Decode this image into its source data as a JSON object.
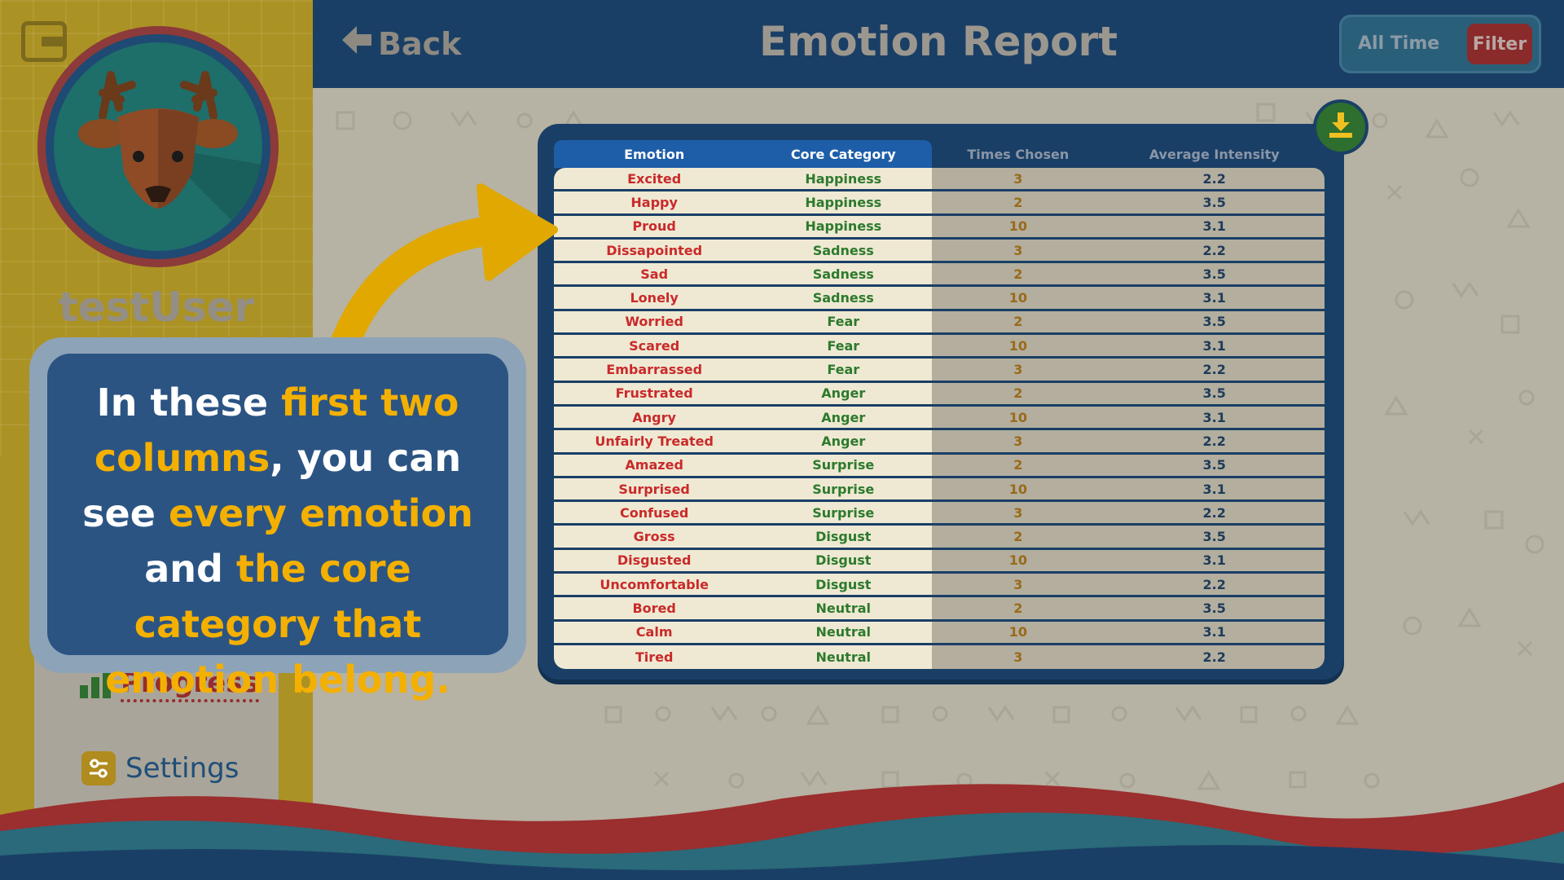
{
  "sidebar": {
    "username": "testUser",
    "nav": [
      {
        "label": "Progress",
        "icon": "bar-chart-icon"
      },
      {
        "label": "Settings",
        "icon": "sliders-icon"
      }
    ],
    "logout_icon": "logout-icon",
    "avatar": "deer-avatar"
  },
  "header": {
    "back_label": "Back",
    "title": "Emotion Report",
    "time_range": "All Time",
    "filter_label": "Filter"
  },
  "table": {
    "columns": [
      "Emotion",
      "Core Category",
      "Times Chosen",
      "Average Intensity"
    ],
    "rows": [
      [
        "Excited",
        "Happiness",
        "3",
        "2.2"
      ],
      [
        "Happy",
        "Happiness",
        "2",
        "3.5"
      ],
      [
        "Proud",
        "Happiness",
        "10",
        "3.1"
      ],
      [
        "Dissapointed",
        "Sadness",
        "3",
        "2.2"
      ],
      [
        "Sad",
        "Sadness",
        "2",
        "3.5"
      ],
      [
        "Lonely",
        "Sadness",
        "10",
        "3.1"
      ],
      [
        "Worried",
        "Fear",
        "2",
        "3.5"
      ],
      [
        "Scared",
        "Fear",
        "10",
        "3.1"
      ],
      [
        "Embarrassed",
        "Fear",
        "3",
        "2.2"
      ],
      [
        "Frustrated",
        "Anger",
        "2",
        "3.5"
      ],
      [
        "Angry",
        "Anger",
        "10",
        "3.1"
      ],
      [
        "Unfairly Treated",
        "Anger",
        "3",
        "2.2"
      ],
      [
        "Amazed",
        "Surprise",
        "2",
        "3.5"
      ],
      [
        "Surprised",
        "Surprise",
        "10",
        "3.1"
      ],
      [
        "Confused",
        "Surprise",
        "3",
        "2.2"
      ],
      [
        "Gross",
        "Disgust",
        "2",
        "3.5"
      ],
      [
        "Disgusted",
        "Disgust",
        "10",
        "3.1"
      ],
      [
        "Uncomfortable",
        "Disgust",
        "3",
        "2.2"
      ],
      [
        "Bored",
        "Neutral",
        "2",
        "3.5"
      ],
      [
        "Calm",
        "Neutral",
        "10",
        "3.1"
      ],
      [
        "Tired",
        "Neutral",
        "3",
        "2.2"
      ]
    ],
    "download_icon": "download-icon"
  },
  "callout": {
    "segments": [
      {
        "text": "In these ",
        "highlight": false
      },
      {
        "text": "first two columns",
        "highlight": true
      },
      {
        "text": ", you can see ",
        "highlight": false
      },
      {
        "text": "every emotion",
        "highlight": true
      },
      {
        "text": " and ",
        "highlight": false
      },
      {
        "text": "the core category",
        "highlight": true
      },
      {
        "text": " that emotion belong.",
        "highlight": true
      }
    ]
  },
  "colors": {
    "header_bg": "#1a3f66",
    "highlight_yellow": "#f4b000",
    "emotion_red": "#c92a2a",
    "category_green": "#2d7a2d",
    "sidebar_gold": "#ab9224"
  }
}
